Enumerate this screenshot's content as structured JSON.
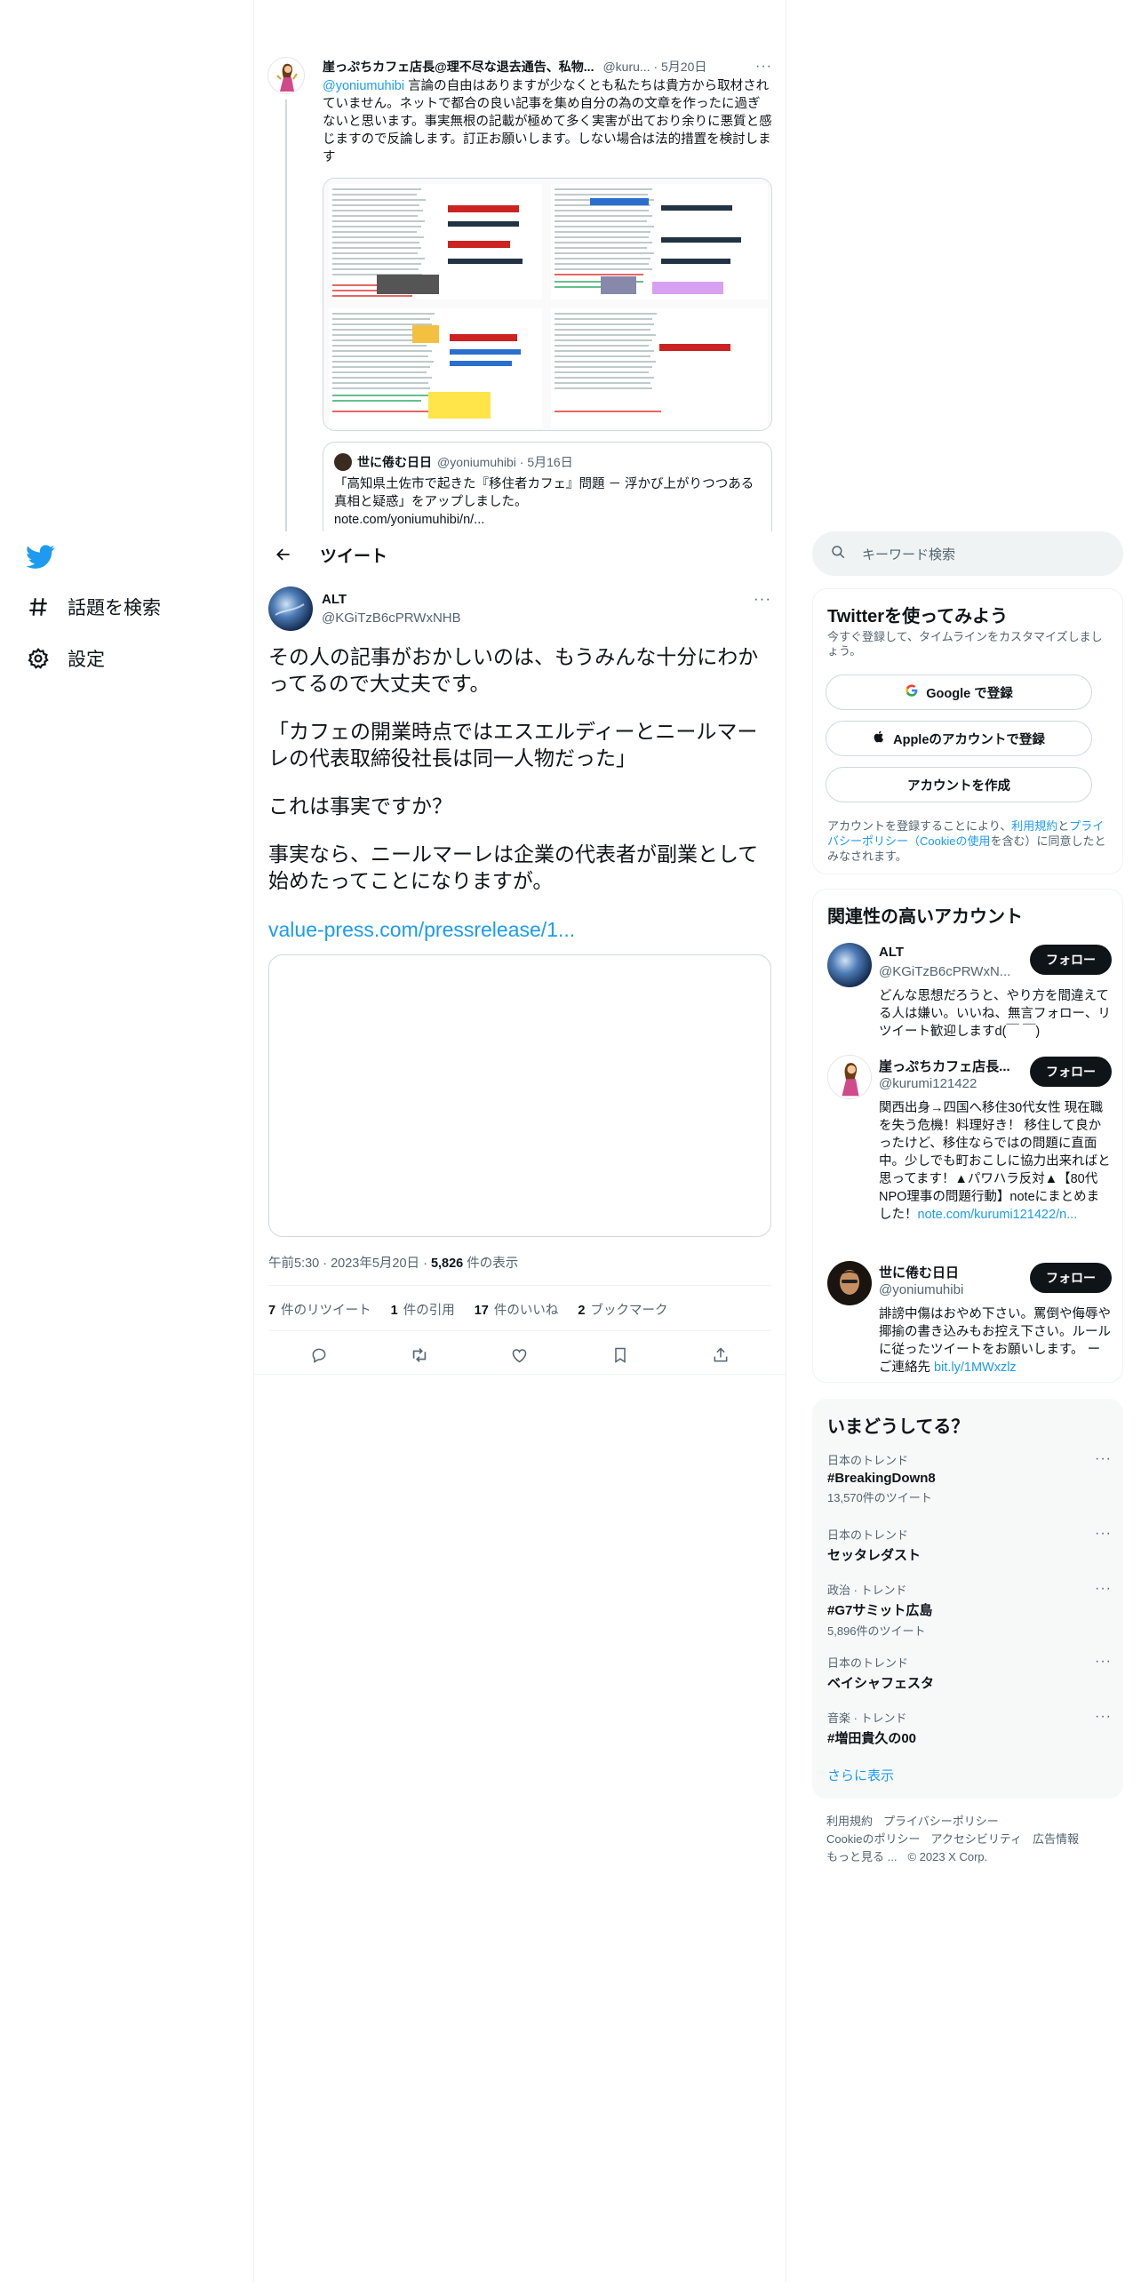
{
  "nav": {
    "explore_label": "話題を検索",
    "settings_label": "設定"
  },
  "parent_tweet": {
    "name": "崖っぷちカフェ店長@理不尽な退去通告、私物...",
    "handle_time": "@kuru... · 5月20日",
    "mention": "@yoniumuhibi",
    "text": " 言論の自由はありますが少なくとも私たちは貴方から取材されていません。ネットで都合の良い記事を集め自分の為の文章を作ったに過ぎないと思います。事実無根の記載が極めて多く実害が出ており余りに悪質と感じますので反論します。訂正お願いします。しない場合は法的措置を検討します",
    "quote": {
      "name": "世に倦む日日",
      "handle_time": "@yoniumuhibi · 5月16日",
      "text": "「高知県土佐市で起きた『移住者カフェ』問題 － 浮かび上がりつつある真相と疑惑」をアップしました。",
      "link": "note.com/yoniumuhibi/n/..."
    }
  },
  "header": {
    "title": "ツイート"
  },
  "main_tweet": {
    "name": "ALT",
    "handle": "@KGiTzB6cPRWxNHB",
    "paragraphs": [
      "その人の記事がおかしいのは、もうみんな十分にわかってるので大丈夫です。",
      "「カフェの開業時点ではエスエルディーとニールマーレの代表取締役社長は同一人物だった」",
      "これは事実ですか？",
      "事実なら、ニールマーレは企業の代表者が副業として始めたってことになりますが。"
    ],
    "link": "value-press.com/pressrelease/1...",
    "meta_time": "午前5:30 · 2023年5月20日 · ",
    "views_count": "5,826",
    "views_label": " 件の表示",
    "stats": {
      "retweets_count": "7",
      "retweets_label": "件のリツイート",
      "quotes_count": "1",
      "quotes_label": "件の引用",
      "likes_count": "17",
      "likes_label": "件のいいね",
      "bookmarks_count": "2",
      "bookmarks_label": "ブックマーク"
    }
  },
  "sidebar": {
    "search_placeholder": "キーワード検索",
    "signup": {
      "title": "Twitterを使ってみよう",
      "subtitle": "今すぐ登録して、タイムラインをカスタマイズしましょう。",
      "google_label": "Google で登録",
      "apple_label": "Appleのアカウントで登録",
      "create_label": "アカウントを作成",
      "legal_prefix": "アカウントを登録することにより、",
      "legal_terms": "利用規約",
      "legal_and": "と",
      "legal_privacy": "プライバシーポリシー（Cookieの使用",
      "legal_suffix": "を含む）に同意したとみなされます。"
    },
    "relevant": {
      "title": "関連性の高いアカウント",
      "follow_label": "フォロー",
      "accounts": [
        {
          "name": "ALT",
          "handle": "@KGiTzB6cPRWxN...",
          "bio": "どんな思想だろうと、やり方を間違えてる人は嫌い。いいね、無言フォロー、リツイート歓迎しますd(￣ ￣)",
          "bio_link": ""
        },
        {
          "name": "崖っぷちカフェ店長...",
          "handle": "@kurumi121422",
          "bio": "関西出身→四国へ移住30代女性 現在職を失う危機！料理好き！ 移住して良かったけど、移住ならではの問題に直面中。少しでも町おこしに協力出来ればと思ってます！▲パワハラ反対▲【80代NPO理事の問題行動】noteにまとめました！",
          "bio_link": "note.com/kurumi121422/n..."
        },
        {
          "name": "世に倦む日日",
          "handle": "@yoniumuhibi",
          "bio": "誹謗中傷はおやめ下さい。罵倒や侮辱や揶揄の書き込みもお控え下さい。ルールに従ったツイートをお願いします。 ー　ご連絡先 ",
          "bio_link": "bit.ly/1MWxzlz"
        }
      ]
    },
    "trends": {
      "title": "いまどうしてる？",
      "items": [
        {
          "context": "日本のトレンド",
          "name": "#BreakingDown8",
          "count": "13,570件のツイート"
        },
        {
          "context": "日本のトレンド",
          "name": "セッタレダスト",
          "count": ""
        },
        {
          "context": "政治 · トレンド",
          "name": "#G7サミット広島",
          "count": "5,896件のツイート"
        },
        {
          "context": "日本のトレンド",
          "name": "ベイシャフェスタ",
          "count": ""
        },
        {
          "context": "音楽 · トレンド",
          "name": "#増田貴久の00",
          "count": ""
        }
      ],
      "show_more": "さらに表示"
    },
    "footer": {
      "terms": "利用規約",
      "privacy": "プライバシーポリシー",
      "cookie": "Cookieのポリシー",
      "accessibility": "アクセシビリティ",
      "ads": "広告情報",
      "more": "もっと見る ...",
      "copyright": "© 2023 X Corp."
    }
  },
  "colors": {
    "accent": "#1d9bf0",
    "text": "#0f1419",
    "muted": "#536471",
    "border": "#eff3f4"
  }
}
